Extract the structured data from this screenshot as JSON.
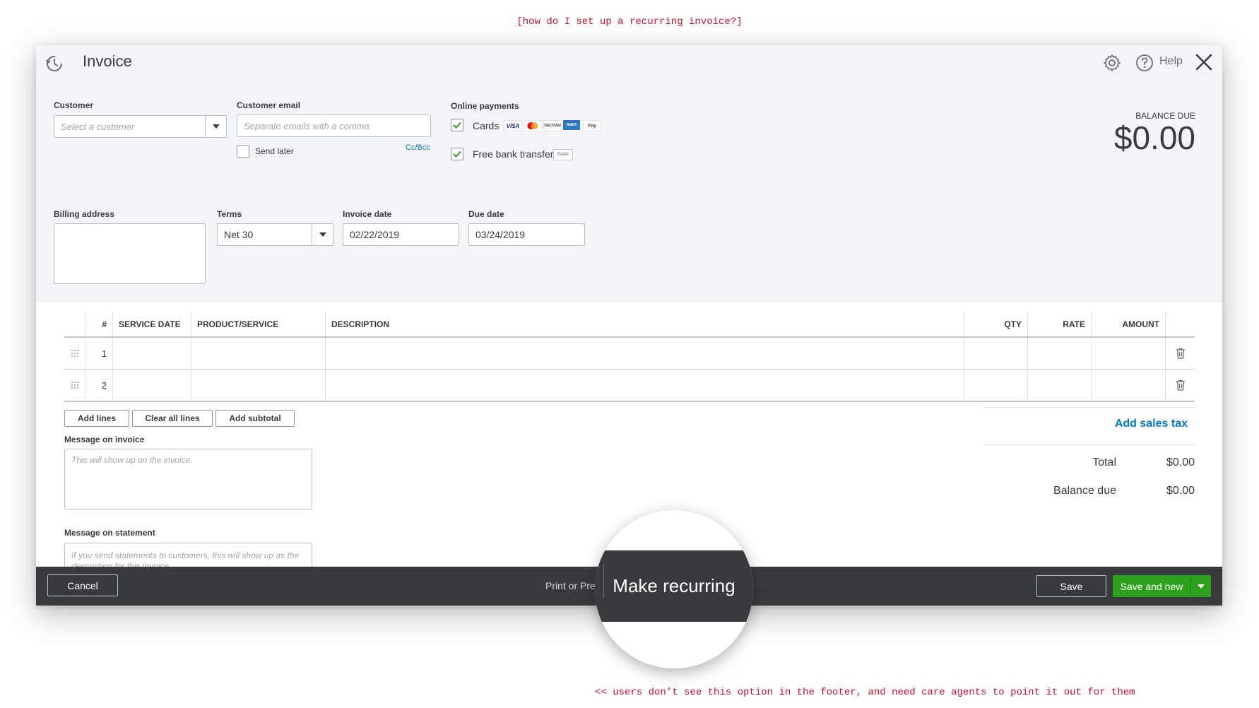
{
  "annotations": {
    "top_note": "[how do I set up a recurring invoice?]",
    "bottom_note": "<< users don’t see this option in the footer, and need care agents to point it out for them"
  },
  "header": {
    "title": "Invoice",
    "help_label": "Help"
  },
  "customer": {
    "label": "Customer",
    "placeholder": "Select a customer"
  },
  "customer_email": {
    "label": "Customer email",
    "placeholder": "Separate emails with a comma",
    "send_later_label": "Send later",
    "cc_bcc_label": "Cc/Bcc"
  },
  "online_payments": {
    "label": "Online payments",
    "cards_label": "Cards",
    "card_brands": [
      "VISA",
      "MC",
      "DISCOVER",
      "AMEX",
      "Pay"
    ],
    "bank_transfer_label": "Free bank transfer",
    "bank_badge": "BANK"
  },
  "balance": {
    "label": "BALANCE DUE",
    "amount": "$0.00"
  },
  "billing_address": {
    "label": "Billing address"
  },
  "terms": {
    "label": "Terms",
    "value": "Net 30"
  },
  "invoice_date": {
    "label": "Invoice date",
    "value": "02/22/2019"
  },
  "due_date": {
    "label": "Due date",
    "value": "03/24/2019"
  },
  "table": {
    "columns": {
      "num": "#",
      "service_date": "SERVICE DATE",
      "product_service": "PRODUCT/SERVICE",
      "description": "DESCRIPTION",
      "qty": "QTY",
      "rate": "RATE",
      "amount": "AMOUNT"
    },
    "rows": [
      {
        "num": "1"
      },
      {
        "num": "2"
      }
    ]
  },
  "table_actions": {
    "add_lines": "Add lines",
    "clear_all_lines": "Clear all lines",
    "add_subtotal": "Add subtotal"
  },
  "message_invoice": {
    "label": "Message on invoice",
    "placeholder": "This will show up on the invoice."
  },
  "message_statement": {
    "label": "Message on statement",
    "placeholder": "If you send statements to customers, this will show up as the description for this invoice."
  },
  "totals": {
    "add_sales_tax": "Add sales tax",
    "total_label": "Total",
    "total_value": "$0.00",
    "balance_due_label": "Balance due",
    "balance_due_value": "$0.00"
  },
  "footer": {
    "cancel": "Cancel",
    "print_or_preview": "Print or Pre",
    "make_recurring": "Make recurring",
    "save": "Save",
    "save_and_new": "Save and new"
  },
  "colors": {
    "accent_green": "#2ca01c",
    "link_blue": "#0077c5",
    "footer_bg": "#393a3d",
    "annotation_red": "#c8102e"
  }
}
